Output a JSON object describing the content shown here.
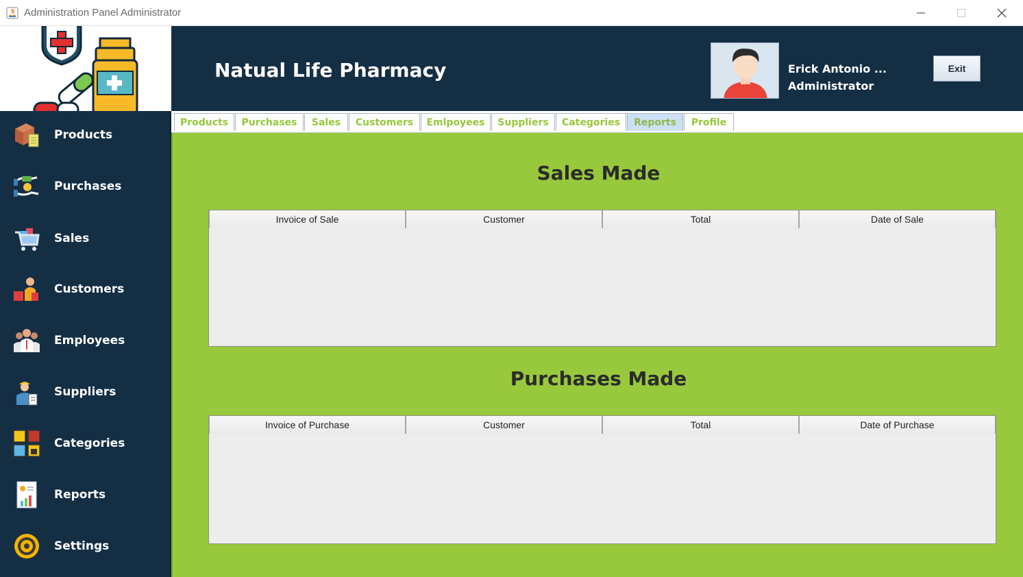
{
  "window": {
    "title": "Administration Panel Administrator",
    "controls": [
      "minimize-icon",
      "maximize-icon",
      "close-icon"
    ]
  },
  "header": {
    "brand": "Natual Life Pharmacy",
    "user_name": "Erick Antonio ...",
    "user_role": "Administrator",
    "exit_label": "Exit"
  },
  "sidebar": {
    "items": [
      {
        "label": "Products",
        "icon": "boxes-icon"
      },
      {
        "label": "Purchases",
        "icon": "handshake-money-icon"
      },
      {
        "label": "Sales",
        "icon": "shopping-cart-icon"
      },
      {
        "label": "Customers",
        "icon": "customers-icon"
      },
      {
        "label": "Employees",
        "icon": "employees-icon"
      },
      {
        "label": "Suppliers",
        "icon": "supplier-icon"
      },
      {
        "label": "Categories",
        "icon": "categories-icon"
      },
      {
        "label": "Reports",
        "icon": "report-icon"
      },
      {
        "label": "Settings",
        "icon": "gear-icon"
      }
    ]
  },
  "tabs": [
    {
      "label": "Products"
    },
    {
      "label": "Purchases"
    },
    {
      "label": "Sales"
    },
    {
      "label": "Customers"
    },
    {
      "label": "Emlpoyees"
    },
    {
      "label": "Suppliers"
    },
    {
      "label": "Categories"
    },
    {
      "label": "Reports",
      "active": true
    },
    {
      "label": "Profile"
    }
  ],
  "sales": {
    "title": "Sales Made",
    "columns": [
      "Invoice of Sale",
      "Customer",
      "Total",
      "Date of Sale"
    ],
    "rows": []
  },
  "purchases": {
    "title": "Purchases Made",
    "columns": [
      "Invoice of Purchase",
      "Customer",
      "Total",
      "Date of Purchase"
    ],
    "rows": []
  },
  "colors": {
    "sidebar_bg": "#142e44",
    "content_bg": "#98c93c",
    "tab_text": "#96c83c",
    "active_tab_bg": "#cde0f3"
  }
}
